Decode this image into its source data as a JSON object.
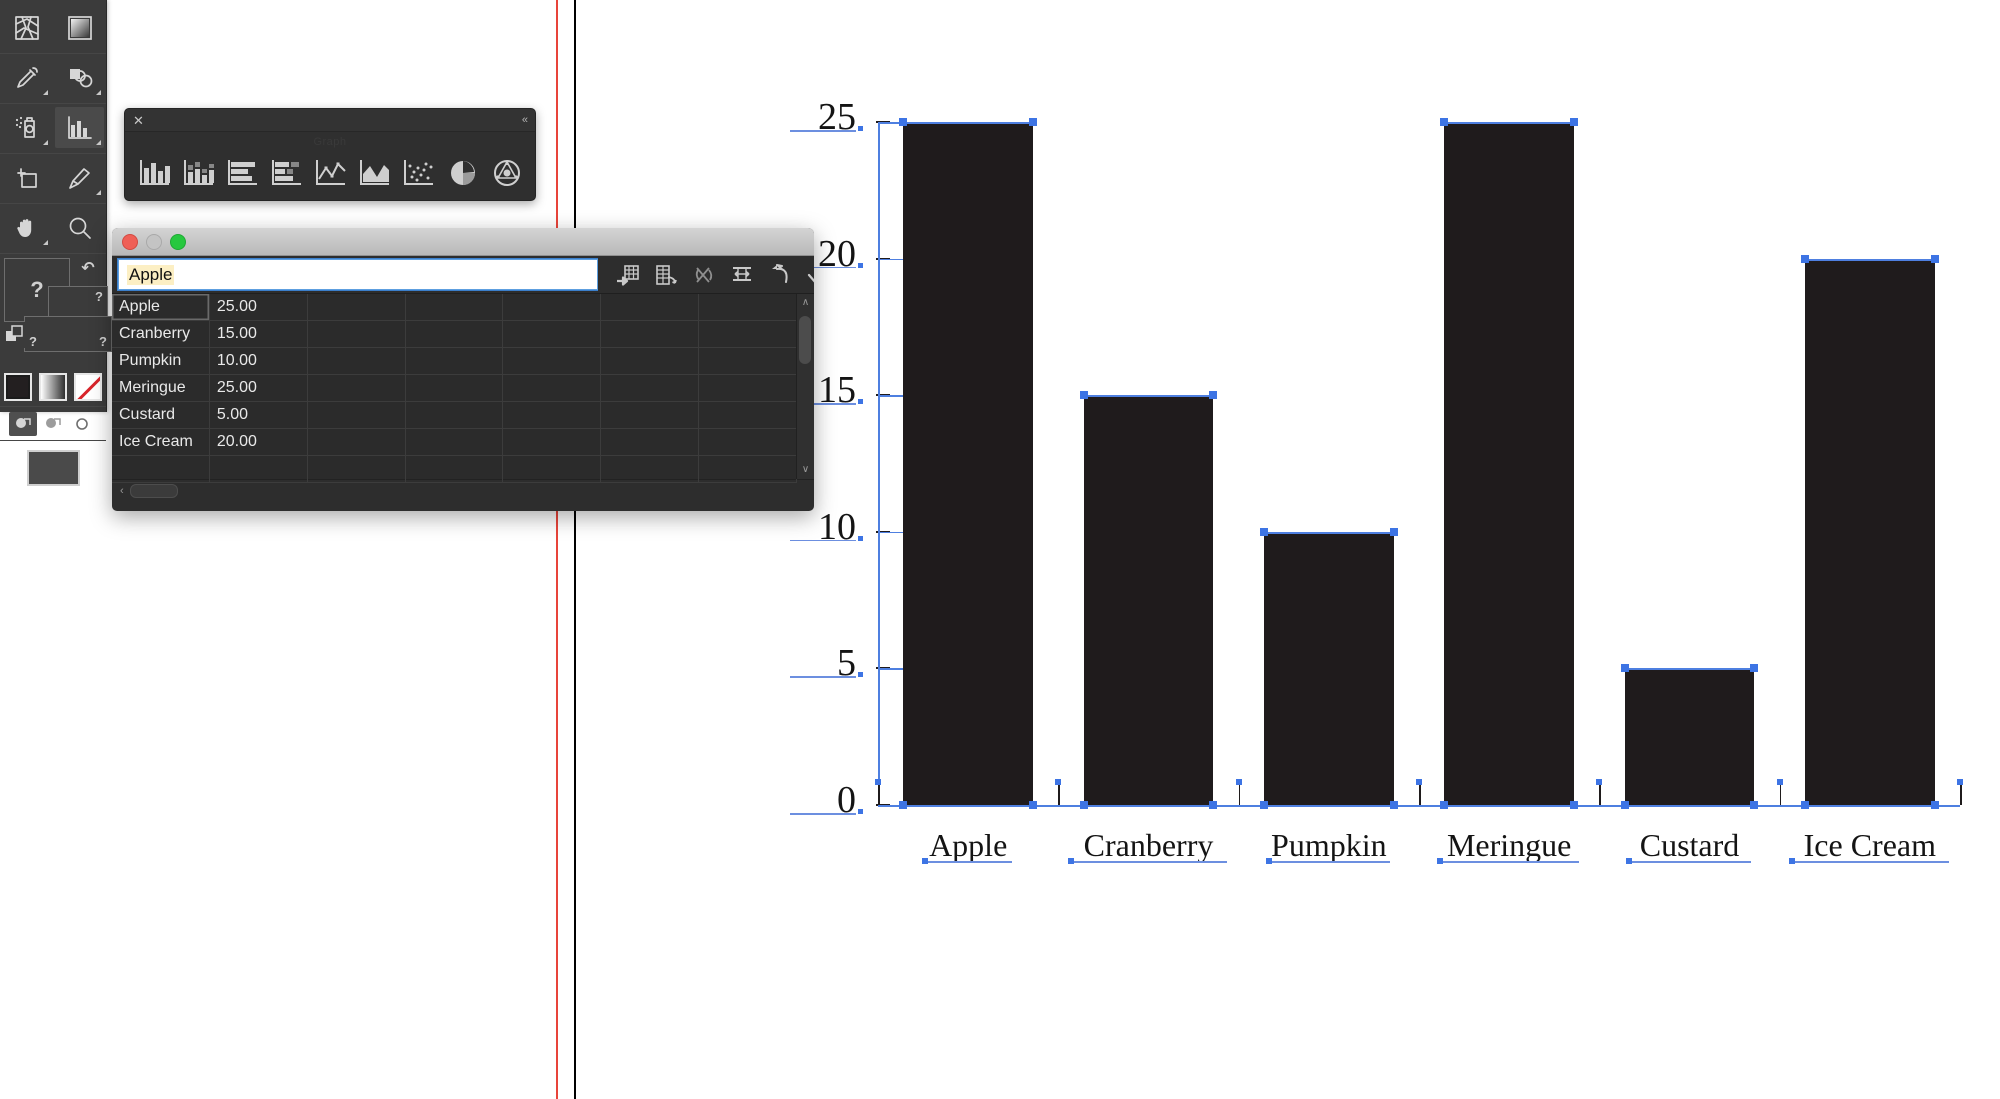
{
  "app": {
    "name": "Adobe Illustrator",
    "document_background": "#ffffff",
    "guide_color": "#e8443a",
    "artboard_edge_color": "#000000"
  },
  "tool_panel": {
    "name": "Tools",
    "background": "#3b3b3b",
    "groups": [
      {
        "tools": [
          {
            "name": "mesh-tool",
            "label": "Mesh Tool",
            "has_flyout": false,
            "selected": false
          },
          {
            "name": "gradient-tool",
            "label": "Gradient Tool",
            "has_flyout": false,
            "selected": false
          }
        ]
      },
      {
        "tools": [
          {
            "name": "eyedropper-tool",
            "label": "Eyedropper Tool",
            "has_flyout": true,
            "selected": false
          },
          {
            "name": "blend-tool",
            "label": "Blend Tool",
            "has_flyout": true,
            "selected": false
          }
        ]
      },
      {
        "tools": [
          {
            "name": "symbol-sprayer-tool",
            "label": "Symbol Sprayer Tool",
            "has_flyout": true,
            "selected": false
          },
          {
            "name": "column-graph-tool",
            "label": "Column Graph Tool",
            "has_flyout": true,
            "selected": true
          }
        ]
      },
      {
        "tools": [
          {
            "name": "artboard-tool",
            "label": "Artboard Tool",
            "has_flyout": false,
            "selected": false
          },
          {
            "name": "slice-tool",
            "label": "Slice Tool",
            "has_flyout": true,
            "selected": false
          }
        ]
      },
      {
        "tools": [
          {
            "name": "hand-tool",
            "label": "Hand Tool",
            "has_flyout": true,
            "selected": false
          },
          {
            "name": "zoom-tool",
            "label": "Zoom Tool",
            "has_flyout": false,
            "selected": false
          }
        ]
      }
    ],
    "placeholder_marks": [
      "?",
      "?",
      "?",
      "?",
      "?"
    ],
    "swatches": [
      {
        "name": "fill-swatch",
        "label": "Fill",
        "color": "#231f20"
      },
      {
        "name": "gradient-swatch",
        "label": "Gradient",
        "color": "#808080"
      },
      {
        "name": "none-swatch",
        "label": "None",
        "color": "#ffffff"
      }
    ],
    "draw_modes": [
      {
        "name": "draw-normal-mode",
        "label": "Draw Normal",
        "selected": true
      },
      {
        "name": "draw-behind-mode",
        "label": "Draw Behind",
        "selected": false
      },
      {
        "name": "draw-inside-mode",
        "label": "Draw Inside",
        "selected": false
      }
    ],
    "screen_mode": {
      "name": "screen-mode-button",
      "label": "Change Screen Mode"
    }
  },
  "graph_panel": {
    "title": "Graph",
    "close_glyph": "✕",
    "collapse_glyph": "«",
    "types": [
      {
        "name": "column-graph-type",
        "label": "Column Graph"
      },
      {
        "name": "stacked-column-graph-type",
        "label": "Stacked Column Graph"
      },
      {
        "name": "bar-graph-type",
        "label": "Bar Graph"
      },
      {
        "name": "stacked-bar-graph-type",
        "label": "Stacked Bar Graph"
      },
      {
        "name": "line-graph-type",
        "label": "Line Graph"
      },
      {
        "name": "area-graph-type",
        "label": "Area Graph"
      },
      {
        "name": "scatter-graph-type",
        "label": "Scatter Graph"
      },
      {
        "name": "pie-graph-type",
        "label": "Pie Graph"
      },
      {
        "name": "radar-graph-type",
        "label": "Radar Graph"
      }
    ]
  },
  "data_window": {
    "title": "",
    "traffic_lights": [
      {
        "name": "close-window-button",
        "label": "Close",
        "color": "#ef5f56"
      },
      {
        "name": "minimize-window-button",
        "label": "Minimize",
        "color": "#c4c4c4"
      },
      {
        "name": "zoom-window-button",
        "label": "Zoom",
        "color": "#27c83f"
      }
    ],
    "entry_field": {
      "name": "cell-entry-field",
      "value": "Apple",
      "placeholder": "",
      "highlight_color": "#fcefc4"
    },
    "toolbar": [
      {
        "name": "import-data-button",
        "label": "Import Data"
      },
      {
        "name": "transpose-row-column-button",
        "label": "Transpose row/column"
      },
      {
        "name": "switch-x-y-button",
        "label": "Switch X/Y"
      },
      {
        "name": "cell-style-button",
        "label": "Cell Style"
      },
      {
        "name": "revert-button",
        "label": "Revert"
      },
      {
        "name": "apply-button",
        "label": "Apply"
      }
    ],
    "columns": 5,
    "rows": [
      {
        "label": "Apple",
        "value": "25.00"
      },
      {
        "label": "Cranberry",
        "value": "15.00"
      },
      {
        "label": "Pumpkin",
        "value": "10.00"
      },
      {
        "label": "Meringue",
        "value": "25.00"
      },
      {
        "label": "Custard",
        "value": "5.00"
      },
      {
        "label": "Ice Cream",
        "value": "20.00"
      }
    ],
    "scroll": {
      "vertical_up_glyph": "∧",
      "vertical_down_glyph": "∨",
      "horizontal_left_glyph": "‹"
    }
  },
  "chart_data": {
    "type": "bar",
    "title": "",
    "xlabel": "",
    "ylabel": "",
    "categories": [
      "Apple",
      "Cranberry",
      "Pumpkin",
      "Meringue",
      "Custard",
      "Ice Cream"
    ],
    "values": [
      25,
      15,
      10,
      25,
      5,
      20
    ],
    "ytick_labels": [
      "0",
      "5",
      "10",
      "15",
      "20",
      "25"
    ],
    "ytick_values": [
      0,
      5,
      10,
      15,
      20,
      25
    ],
    "ylim": [
      0,
      25
    ],
    "grid": false,
    "legend": false,
    "bar_color": "#1f1b1c",
    "selection_color": "#3d74e4",
    "selected": true
  }
}
